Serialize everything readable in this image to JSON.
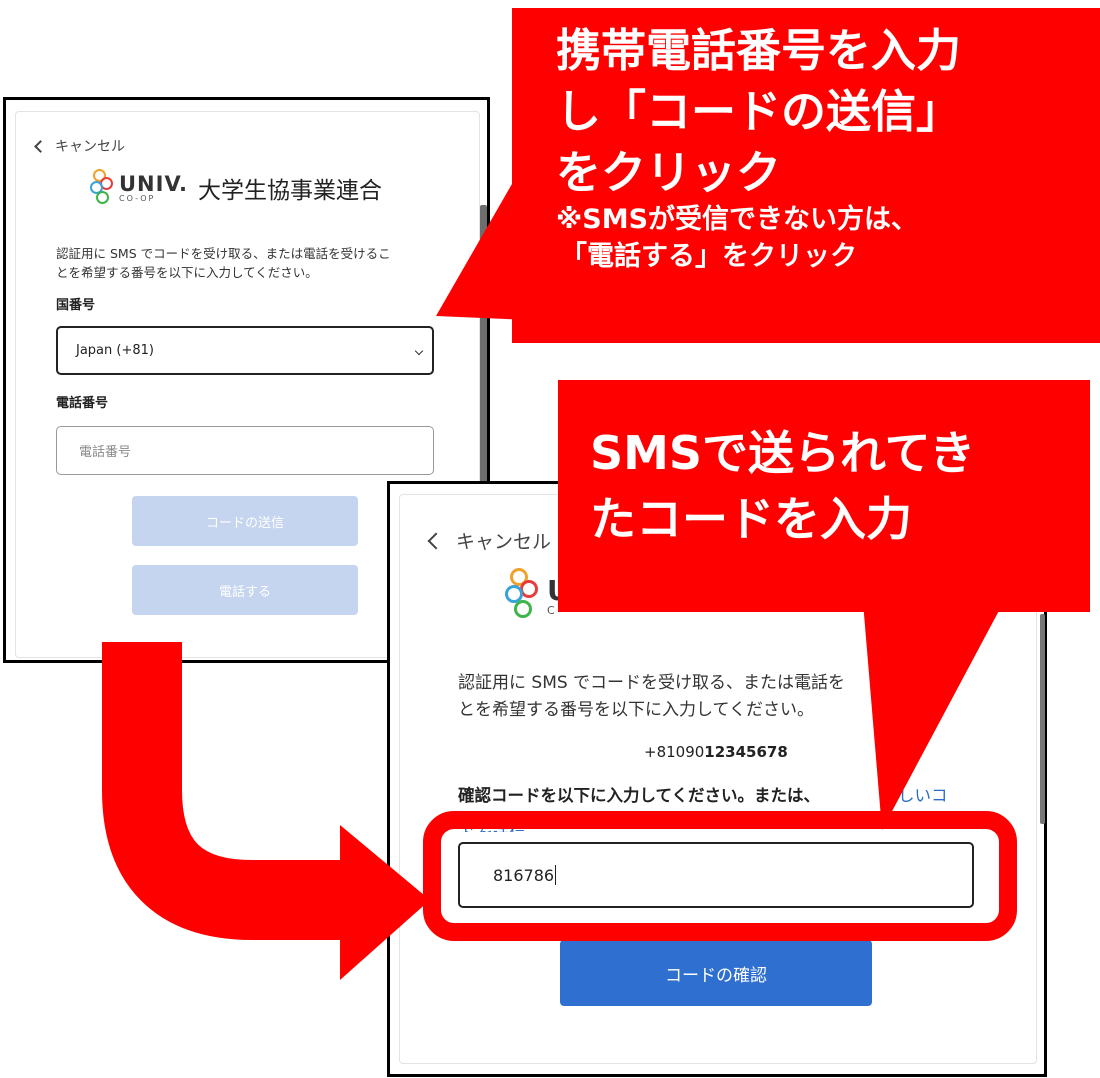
{
  "panel1": {
    "cancel_label": "キャンセル",
    "logo_mark": "UNIV.",
    "logo_sub": "CO-OP",
    "org_name": "大学生協事業連合",
    "description_line1": "認証用に SMS でコードを受け取る、または電話を受けるこ",
    "description_line2": "とを希望する番号を以下に入力してください。",
    "country_label": "国番号",
    "country_value": "Japan (+81)",
    "phone_label": "電話番号",
    "phone_placeholder": "電話番号",
    "send_code_button": "コードの送信",
    "call_button": "電話する"
  },
  "panel2": {
    "cancel_label": "キャンセル",
    "logo_mark": "U",
    "logo_sub": "C",
    "description_line1": "認証用に SMS でコードを受け取る、または電話を",
    "description_line2": "とを希望する番号を以下に入力してください。",
    "phone_prefix": "+81090",
    "phone_rest": "12345678",
    "verify_prompt": "確認コードを以下に入力してください。または、",
    "resend_link": "しいコ",
    "resend_link_line2": "ドを送信",
    "code_value": "816786",
    "confirm_button": "コードの確認"
  },
  "callout1": {
    "line1": "携帯電話番号を入力",
    "line2": "し「コードの送信」",
    "line3": "をクリック",
    "note1": "※SMSが受信できない方は、",
    "note2": "「電話する」をクリック"
  },
  "callout2": {
    "line1": "SMSで送られてき",
    "line2": "たコードを入力"
  },
  "colors": {
    "callout_red": "#ff0000",
    "button_disabled": "#c5d5ef",
    "button_primary": "#2f6fd0",
    "link_blue": "#2b6cc4"
  },
  "icons": [
    "chevron-left-icon",
    "chevron-down-icon",
    "coop-logo-icon",
    "arrow-icon"
  ]
}
